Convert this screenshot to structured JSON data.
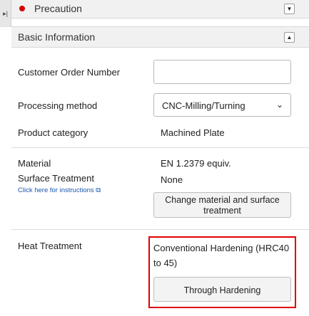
{
  "left_tab": {
    "icon": "collapse-icon"
  },
  "precaution": {
    "title": "Precaution",
    "status_color": "#d40000",
    "toggle_icon": "chevron-down-icon"
  },
  "basic_info": {
    "title": "Basic Information",
    "toggle_icon": "chevron-up-icon"
  },
  "fields": {
    "customer_order_number": {
      "label": "Customer Order Number",
      "value": ""
    },
    "processing_method": {
      "label": "Processing method",
      "selected": "CNC-Milling/Turning"
    },
    "product_category": {
      "label": "Product category",
      "value": "Machined Plate"
    },
    "material": {
      "label": "Material",
      "value": "EN 1.2379 equiv."
    },
    "surface_treatment": {
      "label": "Surface Treatment",
      "value": "None",
      "link": "Click here for instructions"
    },
    "change_button": "Change material and surface treatment",
    "heat_treatment": {
      "label": "Heat Treatment",
      "value": "Conventional Hardening (HRC40 to 45)",
      "button": "Through Hardening"
    }
  },
  "colors": {
    "highlight": "#e00000",
    "link": "#1a56b0"
  }
}
